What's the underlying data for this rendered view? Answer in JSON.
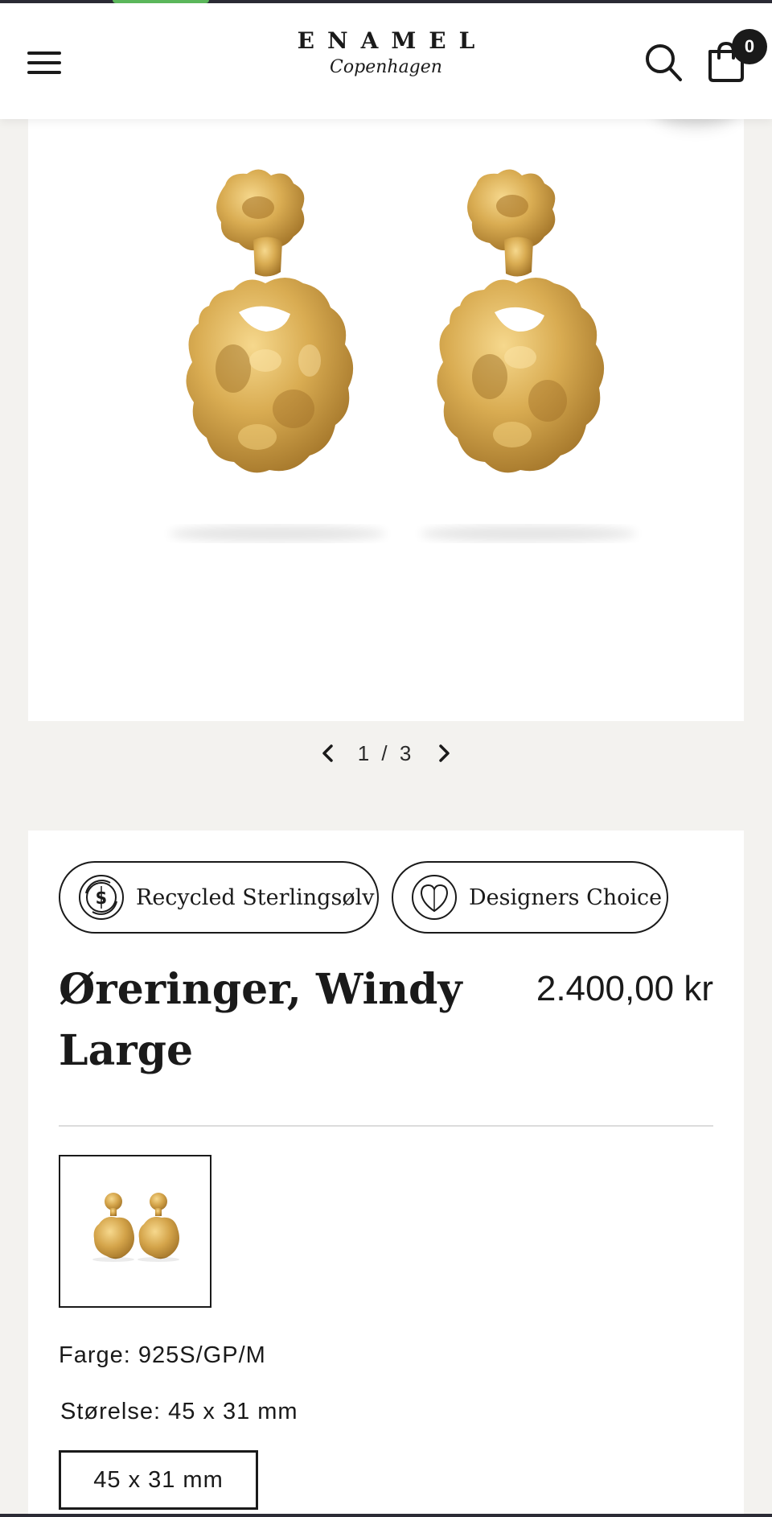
{
  "header": {
    "brand": "ENAMEL",
    "city": "Copenhagen",
    "cart_count": "0",
    "icons": {
      "menu": "hamburger-menu-icon",
      "search": "search-icon",
      "cart": "shopping-bag-icon"
    }
  },
  "gallery": {
    "pager_text": "1 / 3",
    "current": 1,
    "total": 3
  },
  "badges": [
    {
      "label": "Recycled Sterlingsølv",
      "icon": "recycled-silver-icon"
    },
    {
      "label": "Designers Choice",
      "icon": "heart-shield-icon"
    }
  ],
  "product": {
    "title": "Øreringer, Windy Large",
    "price": "2.400,00 kr"
  },
  "attributes": {
    "color_label": "Farge:",
    "color_value": "925S/GP/M",
    "size_label": "Størelse:",
    "size_value": "45 x 31 mm",
    "size_option": "45 x 31 mm"
  },
  "colors": {
    "accent": "#1a1a1a",
    "gold": "#d9ac52",
    "background": "#f3f2ef"
  }
}
